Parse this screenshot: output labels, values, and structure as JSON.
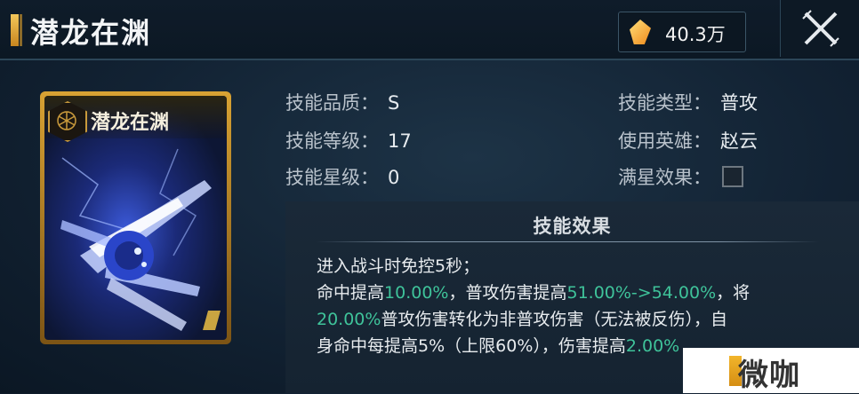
{
  "header": {
    "title": "潜龙在渊",
    "currency_value": "40.3万"
  },
  "card": {
    "name": "潜龙在渊"
  },
  "info": {
    "left": [
      {
        "label": "技能品质：",
        "value": "S"
      },
      {
        "label": "技能等级：",
        "value": "17"
      },
      {
        "label": "技能星级：",
        "value": "0"
      }
    ],
    "right": [
      {
        "label": "技能类型：",
        "value": "普攻"
      },
      {
        "label": "使用英雄：",
        "value": "赵云"
      },
      {
        "label": "满星效果：",
        "value": ""
      }
    ]
  },
  "effect": {
    "title": "技能效果",
    "line1": "进入战斗时免控5秒；",
    "l2a": "命中提高",
    "l2b": "10.00%",
    "l2c": "，普攻伤害提高",
    "l2d": "51.00%->54.00%",
    "l2e": "，将",
    "l3a": "20.00%",
    "l3b": "普攻伤害转化为非普攻伤害（无法被反伤），自",
    "l4a": "身命中每提高5%（上限60%），伤害提高",
    "l4b": "2.00%"
  },
  "watermark": {
    "text": "微咖"
  },
  "colors": {
    "highlight": "#3fc39a",
    "gold": "#d8a233",
    "background": "#122233"
  }
}
